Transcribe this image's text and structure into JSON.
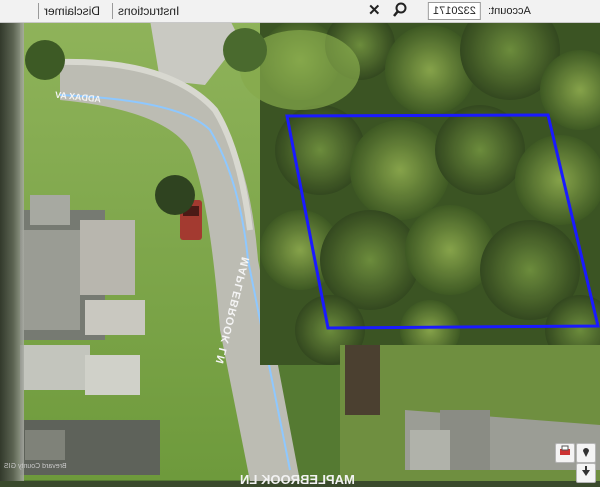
{
  "toolbar": {
    "account_label": "Account:",
    "account_value": "2320171",
    "disclaimer_label": "Disclaimer",
    "instructions_label": "Instructions"
  },
  "map": {
    "street_main": "MAPLEBROOK LN",
    "street_top": "ADDAX AV",
    "bottom_label": "MAPLEBROOK LN",
    "copyright": "Brevard County GIS",
    "parcel_outline_color": "#1a1aff",
    "road_centerline_color": "#8ec8ff"
  },
  "icons": {
    "search": "search-icon",
    "close": "close-icon",
    "print": "print-icon",
    "pin": "pin-icon",
    "arrow": "arrow-icon"
  }
}
